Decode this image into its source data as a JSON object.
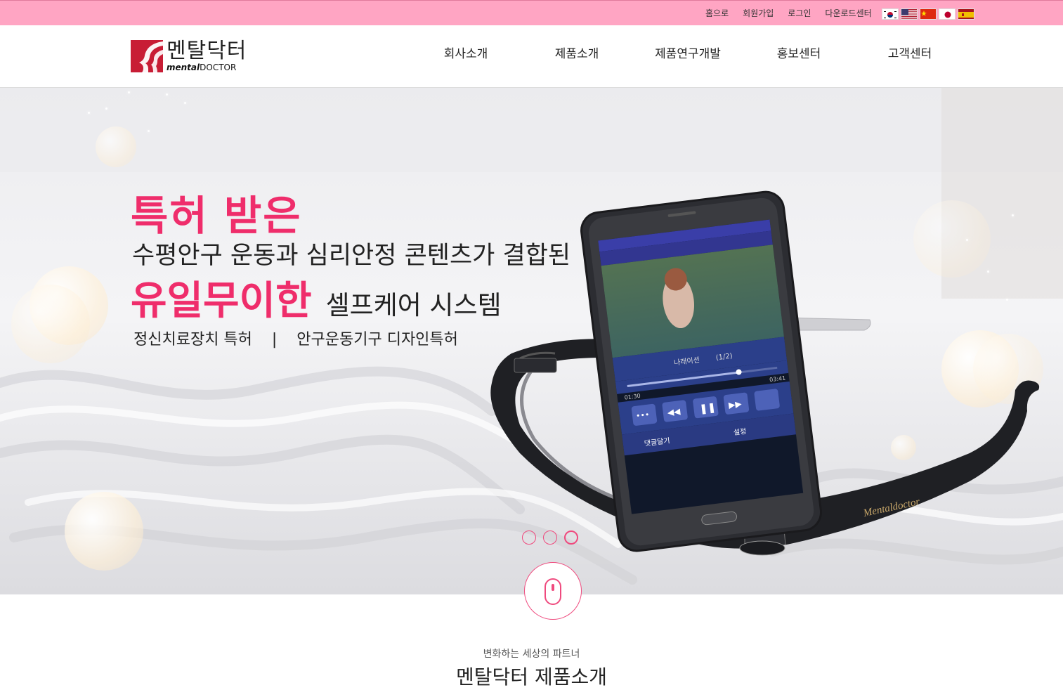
{
  "top_links": [
    "홈으로",
    "회원가입",
    "로그인",
    "다운로드센터"
  ],
  "flags": [
    "korea-flag-icon",
    "usa-flag-icon",
    "china-flag-icon",
    "japan-flag-icon",
    "spain-flag-icon"
  ],
  "logo": {
    "ko": "멘탈닥터",
    "en_bold": "mental",
    "en_rest": "DOCTOR"
  },
  "nav": [
    "회사소개",
    "제품소개",
    "제품연구개발",
    "홍보센터",
    "고객센터"
  ],
  "hero": {
    "line1": "특허 받은",
    "line2": "수평안구 운동과 심리안정 콘텐츠가 결합된",
    "line3_big": "유일무이한",
    "line3_rest": "셀프케어 시스템",
    "line4": "정신치료장치 특허    |    안구운동기구 디자인특허"
  },
  "phone": {
    "song": "나래이션",
    "track": "(1/2)",
    "time_start": "01:30",
    "time_end": "03:41",
    "comment_btn": "댓글달기",
    "settings_btn": "설정"
  },
  "device_brand": "Mentaldoctor",
  "slider": {
    "count": 3,
    "active_index": 2
  },
  "section": {
    "tagline": "변화하는 세상의 파트너",
    "title": "멘탈닥터 제품소개"
  },
  "colors": {
    "pink_bar": "#ffa5c3",
    "accent": "#ef2d6b",
    "logo_red": "#c81d35"
  }
}
